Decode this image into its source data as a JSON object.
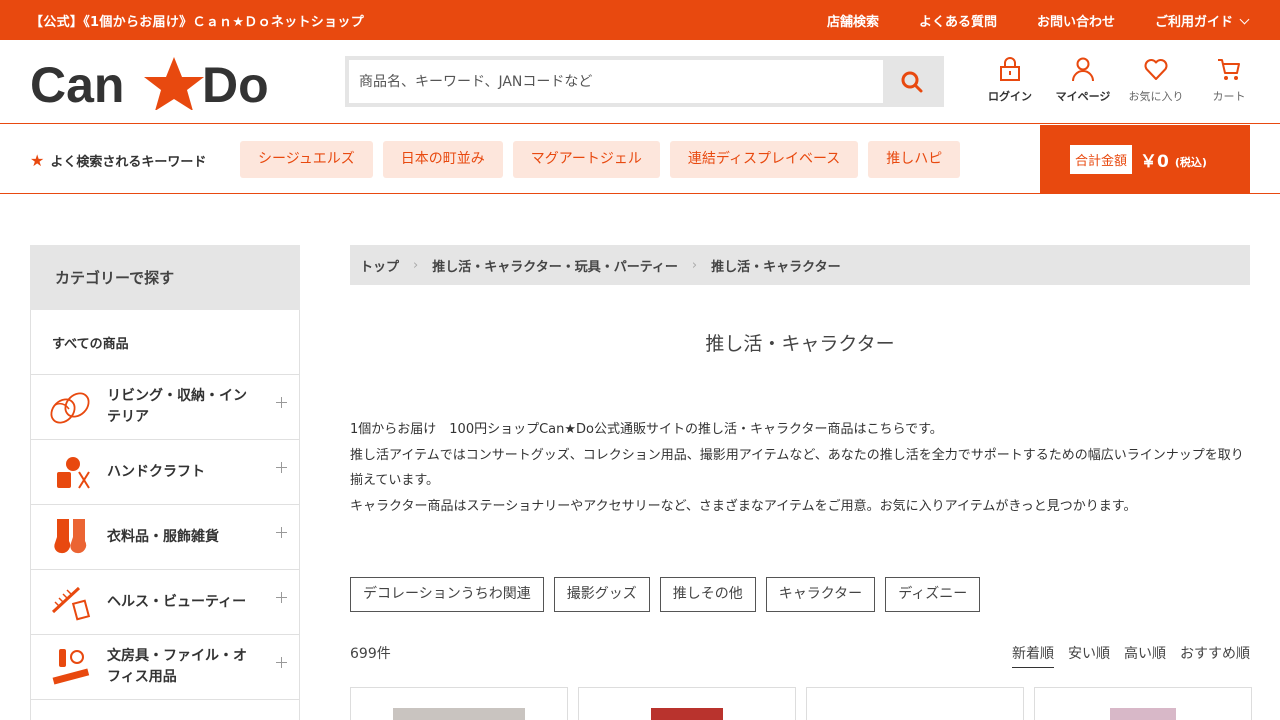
{
  "topbar": {
    "notice": "【公式】《1個からお届け》Ｃａｎ★Ｄｏネットショップ",
    "nav": [
      "店舗検索",
      "よくある質問",
      "お問い合わせ",
      "ご利用ガイド"
    ]
  },
  "header": {
    "logo_text": "Can★Do",
    "search_placeholder": "商品名、キーワード、JANコードなど",
    "icons": [
      {
        "label": "ログイン",
        "icon": "lock-icon"
      },
      {
        "label": "マイページ",
        "icon": "person-icon"
      },
      {
        "label": "お気に入り",
        "icon": "heart-icon"
      },
      {
        "label": "カート",
        "icon": "cart-icon"
      }
    ]
  },
  "keywords": {
    "title": "よく検索されるキーワード",
    "tags": [
      "シージュエルズ",
      "日本の町並み",
      "マグアートジェル",
      "連結ディスプレイベース",
      "推しハピ"
    ]
  },
  "cart": {
    "label": "合計金額",
    "amount": "￥0",
    "tax": "(税込)"
  },
  "sidebar": {
    "title": "カテゴリーで探す",
    "all": "すべての商品",
    "items": [
      {
        "label": "リビング・収納・インテリア",
        "icon": "slippers-icon"
      },
      {
        "label": "ハンドクラフト",
        "icon": "craft-icon"
      },
      {
        "label": "衣料品・服飾雑貨",
        "icon": "socks-icon"
      },
      {
        "label": "ヘルス・ビューティー",
        "icon": "comb-icon"
      },
      {
        "label": "文房具・ファイル・オフィス用品",
        "icon": "stationery-icon"
      }
    ]
  },
  "breadcrumb": [
    "トップ",
    "推し活・キャラクター・玩具・パーティー",
    "推し活・キャラクター"
  ],
  "page": {
    "title": "推し活・キャラクター",
    "desc": [
      "1個からお届け　100円ショップCan★Do公式通販サイトの推し活・キャラクター商品はこちらです。",
      "推し活アイテムではコンサートグッズ、コレクション用品、撮影用アイテムなど、あなたの推し活を全力でサポートするための幅広いラインナップを取り揃えています。",
      "キャラクター商品はステーショナリーやアクセサリーなど、さまざまなアイテムをご用意。お気に入りアイテムがきっと見つかります。"
    ],
    "subcats": [
      "デコレーションうちわ関連",
      "撮影グッズ",
      "推しその他",
      "キャラクター",
      "ディズニー"
    ],
    "count": "699件",
    "sorts": [
      "新着順",
      "安い順",
      "高い順",
      "おすすめ順"
    ],
    "active_sort": "新着順"
  },
  "colors": {
    "brand": "#e8490f",
    "tag_bg": "#fde6dc",
    "panel": "#e5e5e5"
  }
}
